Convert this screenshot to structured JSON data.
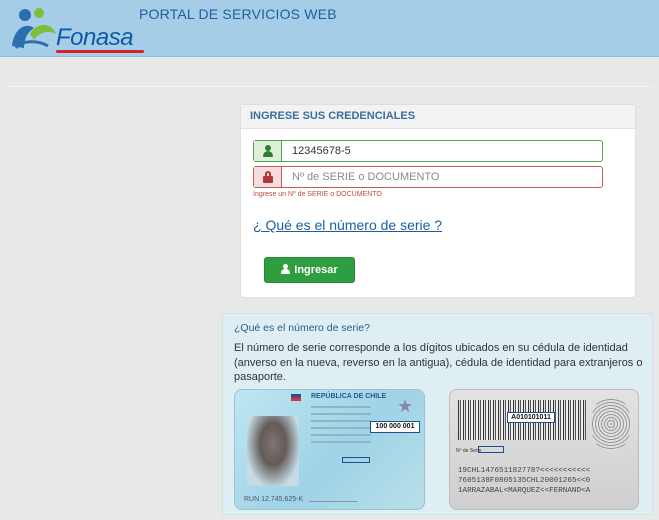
{
  "header": {
    "logo_text": "Fonasa",
    "portal_title": "PORTAL DE SERVICIOS WEB"
  },
  "login": {
    "heading": "INGRESE SUS CREDENCIALES",
    "rut_value": "12345678-5",
    "serie_placeholder": "Nº de SERIE o DOCUMENTO",
    "serie_error": "Ingrese un Nº de SERIE o DOCUMENTO",
    "serie_help_link": "¿ Qué es el número de serie ?",
    "submit_label": "Ingresar"
  },
  "info": {
    "title": "¿Qué es el número de serie?",
    "text": "El número de serie corresponde a los dígitos ubicados en su cédula de identidad (anverso en la nueva, reverso en la antigua), cédula de identidad para extranjeros o pasaporte."
  },
  "card_front": {
    "header": "REPÚBLICA DE CHILE",
    "serial": "100 000 001",
    "run": "RUN 12.745.625-K"
  },
  "card_back": {
    "serial": "A010101011",
    "serie_label": "Nº de Serie",
    "mrz": [
      "19CHL147651182778?<<<<<<<<<<<",
      "7605138F0805135CHL20001265<<0",
      "1ARRAZABAL<MARQUEZ<<FERNAND<A"
    ]
  },
  "colors": {
    "header_bg": "#a5cde8",
    "accent_blue": "#3a6ea3",
    "success_green": "#2f9e41",
    "error_red": "#b94a48"
  }
}
